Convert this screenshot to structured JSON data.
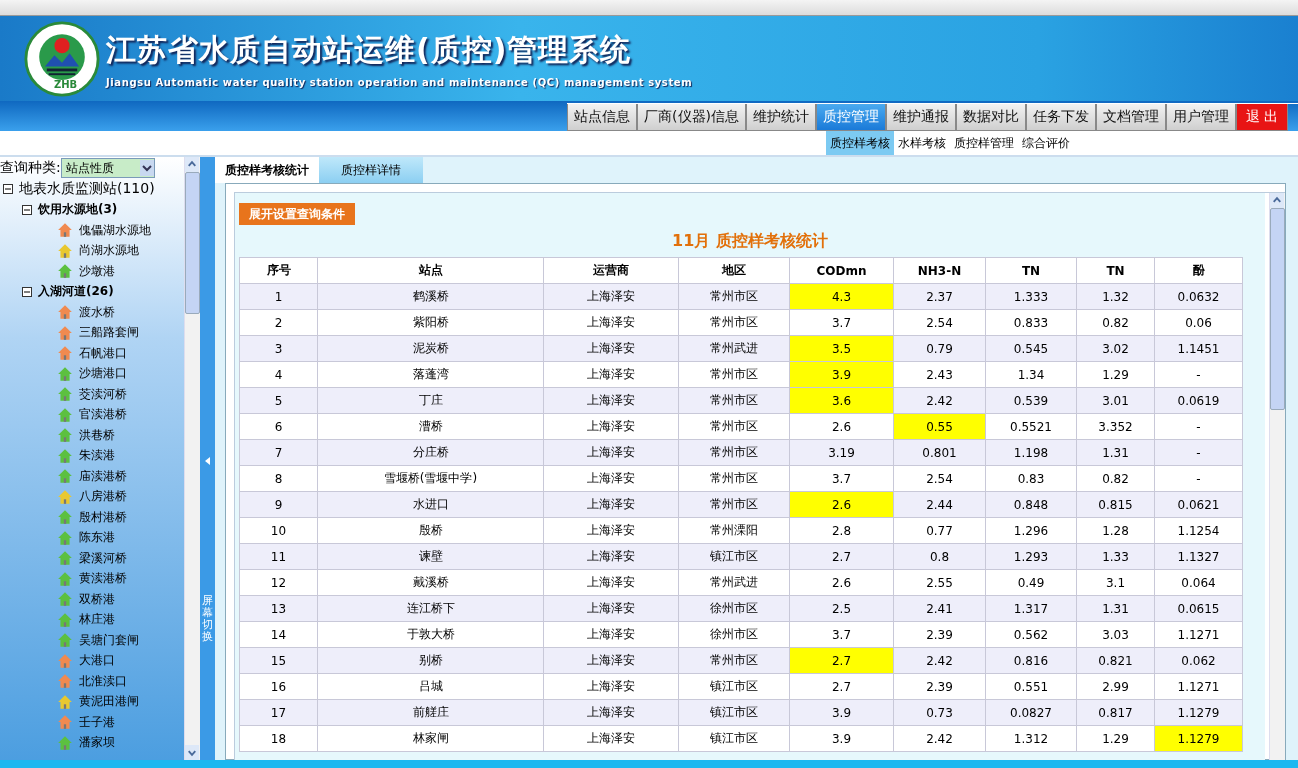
{
  "header": {
    "title": "江苏省水质自动站运维(质控)管理系统",
    "subtitle": "Jiangsu Automatic water quality station operation and maintenance (QC) management system",
    "logo_text": "ZHB"
  },
  "nav": [
    {
      "label": "站点信息",
      "selected": false,
      "kind": "menu"
    },
    {
      "label": "厂商(仪器)信息",
      "selected": false,
      "kind": "menu"
    },
    {
      "label": "维护统计",
      "selected": false,
      "kind": "menu"
    },
    {
      "label": "质控管理",
      "selected": true,
      "kind": "menu"
    },
    {
      "label": "维护通报",
      "selected": false,
      "kind": "menu"
    },
    {
      "label": "数据对比",
      "selected": false,
      "kind": "menu"
    },
    {
      "label": "任务下发",
      "selected": false,
      "kind": "menu"
    },
    {
      "label": "文档管理",
      "selected": false,
      "kind": "menu"
    },
    {
      "label": "用户管理",
      "selected": false,
      "kind": "menu"
    },
    {
      "label": "退  出",
      "selected": false,
      "kind": "exit"
    }
  ],
  "subnav": [
    {
      "label": "质控样考核",
      "selected": true
    },
    {
      "label": "水样考核",
      "selected": false
    },
    {
      "label": "质控样管理",
      "selected": false
    },
    {
      "label": "综合评价",
      "selected": false
    }
  ],
  "sidebar": {
    "query_label": "查询种类:",
    "query_value": "站点性质",
    "tree": {
      "label": "地表水质监测站(110)",
      "expanded": true,
      "children": [
        {
          "label": "饮用水源地(3)",
          "expanded": true,
          "children": [
            {
              "label": "傀儡湖水源地",
              "color": "#f08a50"
            },
            {
              "label": "尚湖水源地",
              "color": "#e8c830"
            },
            {
              "label": "沙墩港",
              "color": "#5cc040"
            }
          ]
        },
        {
          "label": "入湖河道(26)",
          "expanded": true,
          "children": [
            {
              "label": "渡水桥",
              "color": "#f08a50"
            },
            {
              "label": "三船路套闸",
              "color": "#f08a50"
            },
            {
              "label": "石帆港口",
              "color": "#f08a50"
            },
            {
              "label": "沙塘港口",
              "color": "#5cc040"
            },
            {
              "label": "茭渎河桥",
              "color": "#5cc040"
            },
            {
              "label": "官渎港桥",
              "color": "#5cc040"
            },
            {
              "label": "洪巷桥",
              "color": "#5cc040"
            },
            {
              "label": "朱渎港",
              "color": "#5cc040"
            },
            {
              "label": "庙渎港桥",
              "color": "#5cc040"
            },
            {
              "label": "八房港桥",
              "color": "#e8c830"
            },
            {
              "label": "殷村港桥",
              "color": "#5cc040"
            },
            {
              "label": "陈东港",
              "color": "#5cc040"
            },
            {
              "label": "梁溪河桥",
              "color": "#5cc040"
            },
            {
              "label": "黄渎港桥",
              "color": "#5cc040"
            },
            {
              "label": "双桥港",
              "color": "#5cc040"
            },
            {
              "label": "林庄港",
              "color": "#5cc040"
            },
            {
              "label": "吴塘门套闸",
              "color": "#5cc040"
            },
            {
              "label": "大港口",
              "color": "#f08a50"
            },
            {
              "label": "北淮渎口",
              "color": "#f08a50"
            },
            {
              "label": "黄泥田港闸",
              "color": "#e8c830"
            },
            {
              "label": "壬子港",
              "color": "#f08a50"
            },
            {
              "label": "潘家坝",
              "color": "#5cc040"
            }
          ]
        }
      ]
    }
  },
  "splitter": {
    "label": "屏幕切换"
  },
  "tabs": [
    {
      "label": "质控样考核统计",
      "selected": true
    },
    {
      "label": "质控样详情",
      "selected": false
    }
  ],
  "panel": {
    "button": "展开设置查询条件",
    "title": "11月 质控样考核统计"
  },
  "table": {
    "columns": [
      "序号",
      "站点",
      "运营商",
      "地区",
      "CODmn",
      "NH3-N",
      "TN",
      "TN",
      "酚"
    ],
    "rows": [
      {
        "cells": [
          "1",
          "鹤溪桥",
          "上海泽安",
          "常州市区"
        ],
        "values": [
          {
            "text": "4.3",
            "flagged": true
          },
          {
            "text": "2.37",
            "flagged": false
          },
          {
            "text": "1.333",
            "flagged": false
          },
          {
            "text": "1.32",
            "flagged": false
          },
          {
            "text": "0.0632",
            "flagged": false
          }
        ]
      },
      {
        "cells": [
          "2",
          "紫阳桥",
          "上海泽安",
          "常州市区"
        ],
        "values": [
          {
            "text": "3.7",
            "flagged": false
          },
          {
            "text": "2.54",
            "flagged": false
          },
          {
            "text": "0.833",
            "flagged": false
          },
          {
            "text": "0.82",
            "flagged": false
          },
          {
            "text": "0.06",
            "flagged": false
          }
        ]
      },
      {
        "cells": [
          "3",
          "泥炭桥",
          "上海泽安",
          "常州武进"
        ],
        "values": [
          {
            "text": "3.5",
            "flagged": true
          },
          {
            "text": "0.79",
            "flagged": false
          },
          {
            "text": "0.545",
            "flagged": false
          },
          {
            "text": "3.02",
            "flagged": false
          },
          {
            "text": "1.1451",
            "flagged": false
          }
        ]
      },
      {
        "cells": [
          "4",
          "落蓬湾",
          "上海泽安",
          "常州市区"
        ],
        "values": [
          {
            "text": "3.9",
            "flagged": true
          },
          {
            "text": "2.43",
            "flagged": false
          },
          {
            "text": "1.34",
            "flagged": false
          },
          {
            "text": "1.29",
            "flagged": false
          },
          {
            "text": "-",
            "flagged": false
          }
        ]
      },
      {
        "cells": [
          "5",
          "丁庄",
          "上海泽安",
          "常州市区"
        ],
        "values": [
          {
            "text": "3.6",
            "flagged": true
          },
          {
            "text": "2.42",
            "flagged": false
          },
          {
            "text": "0.539",
            "flagged": false
          },
          {
            "text": "3.01",
            "flagged": false
          },
          {
            "text": "0.0619",
            "flagged": false
          }
        ]
      },
      {
        "cells": [
          "6",
          "漕桥",
          "上海泽安",
          "常州市区"
        ],
        "values": [
          {
            "text": "2.6",
            "flagged": false
          },
          {
            "text": "0.55",
            "flagged": true
          },
          {
            "text": "0.5521",
            "flagged": false
          },
          {
            "text": "3.352",
            "flagged": false
          },
          {
            "text": "-",
            "flagged": false
          }
        ]
      },
      {
        "cells": [
          "7",
          "分庄桥",
          "上海泽安",
          "常州市区"
        ],
        "values": [
          {
            "text": "3.19",
            "flagged": false
          },
          {
            "text": "0.801",
            "flagged": false
          },
          {
            "text": "1.198",
            "flagged": false
          },
          {
            "text": "1.31",
            "flagged": false
          },
          {
            "text": "-",
            "flagged": false
          }
        ]
      },
      {
        "cells": [
          "8",
          "雪堰桥(雪堰中学)",
          "上海泽安",
          "常州市区"
        ],
        "values": [
          {
            "text": "3.7",
            "flagged": false
          },
          {
            "text": "2.54",
            "flagged": false
          },
          {
            "text": "0.83",
            "flagged": false
          },
          {
            "text": "0.82",
            "flagged": false
          },
          {
            "text": "-",
            "flagged": false
          }
        ]
      },
      {
        "cells": [
          "9",
          "水进口",
          "上海泽安",
          "常州市区"
        ],
        "values": [
          {
            "text": "2.6",
            "flagged": true
          },
          {
            "text": "2.44",
            "flagged": false
          },
          {
            "text": "0.848",
            "flagged": false
          },
          {
            "text": "0.815",
            "flagged": false
          },
          {
            "text": "0.0621",
            "flagged": false
          }
        ]
      },
      {
        "cells": [
          "10",
          "殷桥",
          "上海泽安",
          "常州溧阳"
        ],
        "values": [
          {
            "text": "2.8",
            "flagged": false
          },
          {
            "text": "0.77",
            "flagged": false
          },
          {
            "text": "1.296",
            "flagged": false
          },
          {
            "text": "1.28",
            "flagged": false
          },
          {
            "text": "1.1254",
            "flagged": false
          }
        ]
      },
      {
        "cells": [
          "11",
          "谏壁",
          "上海泽安",
          "镇江市区"
        ],
        "values": [
          {
            "text": "2.7",
            "flagged": false
          },
          {
            "text": "0.8",
            "flagged": false
          },
          {
            "text": "1.293",
            "flagged": false
          },
          {
            "text": "1.33",
            "flagged": false
          },
          {
            "text": "1.1327",
            "flagged": false
          }
        ]
      },
      {
        "cells": [
          "12",
          "戴溪桥",
          "上海泽安",
          "常州武进"
        ],
        "values": [
          {
            "text": "2.6",
            "flagged": false
          },
          {
            "text": "2.55",
            "flagged": false
          },
          {
            "text": "0.49",
            "flagged": false
          },
          {
            "text": "3.1",
            "flagged": false
          },
          {
            "text": "0.064",
            "flagged": false
          }
        ]
      },
      {
        "cells": [
          "13",
          "连江桥下",
          "上海泽安",
          "徐州市区"
        ],
        "values": [
          {
            "text": "2.5",
            "flagged": false
          },
          {
            "text": "2.41",
            "flagged": false
          },
          {
            "text": "1.317",
            "flagged": false
          },
          {
            "text": "1.31",
            "flagged": false
          },
          {
            "text": "0.0615",
            "flagged": false
          }
        ]
      },
      {
        "cells": [
          "14",
          "于敦大桥",
          "上海泽安",
          "徐州市区"
        ],
        "values": [
          {
            "text": "3.7",
            "flagged": false
          },
          {
            "text": "2.39",
            "flagged": false
          },
          {
            "text": "0.562",
            "flagged": false
          },
          {
            "text": "3.03",
            "flagged": false
          },
          {
            "text": "1.1271",
            "flagged": false
          }
        ]
      },
      {
        "cells": [
          "15",
          "别桥",
          "上海泽安",
          "常州市区"
        ],
        "values": [
          {
            "text": "2.7",
            "flagged": true
          },
          {
            "text": "2.42",
            "flagged": false
          },
          {
            "text": "0.816",
            "flagged": false
          },
          {
            "text": "0.821",
            "flagged": false
          },
          {
            "text": "0.062",
            "flagged": false
          }
        ]
      },
      {
        "cells": [
          "16",
          "吕城",
          "上海泽安",
          "镇江市区"
        ],
        "values": [
          {
            "text": "2.7",
            "flagged": false
          },
          {
            "text": "2.39",
            "flagged": false
          },
          {
            "text": "0.551",
            "flagged": false
          },
          {
            "text": "2.99",
            "flagged": false
          },
          {
            "text": "1.1271",
            "flagged": false
          }
        ]
      },
      {
        "cells": [
          "17",
          "前艖庄",
          "上海泽安",
          "镇江市区"
        ],
        "values": [
          {
            "text": "3.9",
            "flagged": false
          },
          {
            "text": "0.73",
            "flagged": false
          },
          {
            "text": "0.0827",
            "flagged": false
          },
          {
            "text": "0.817",
            "flagged": false
          },
          {
            "text": "1.1279",
            "flagged": false
          }
        ]
      },
      {
        "cells": [
          "18",
          "林家闸",
          "上海泽安",
          "镇江市区"
        ],
        "values": [
          {
            "text": "3.9",
            "flagged": false
          },
          {
            "text": "2.42",
            "flagged": false
          },
          {
            "text": "1.312",
            "flagged": false
          },
          {
            "text": "1.29",
            "flagged": false
          },
          {
            "text": "1.1279",
            "flagged": true
          }
        ]
      }
    ]
  }
}
